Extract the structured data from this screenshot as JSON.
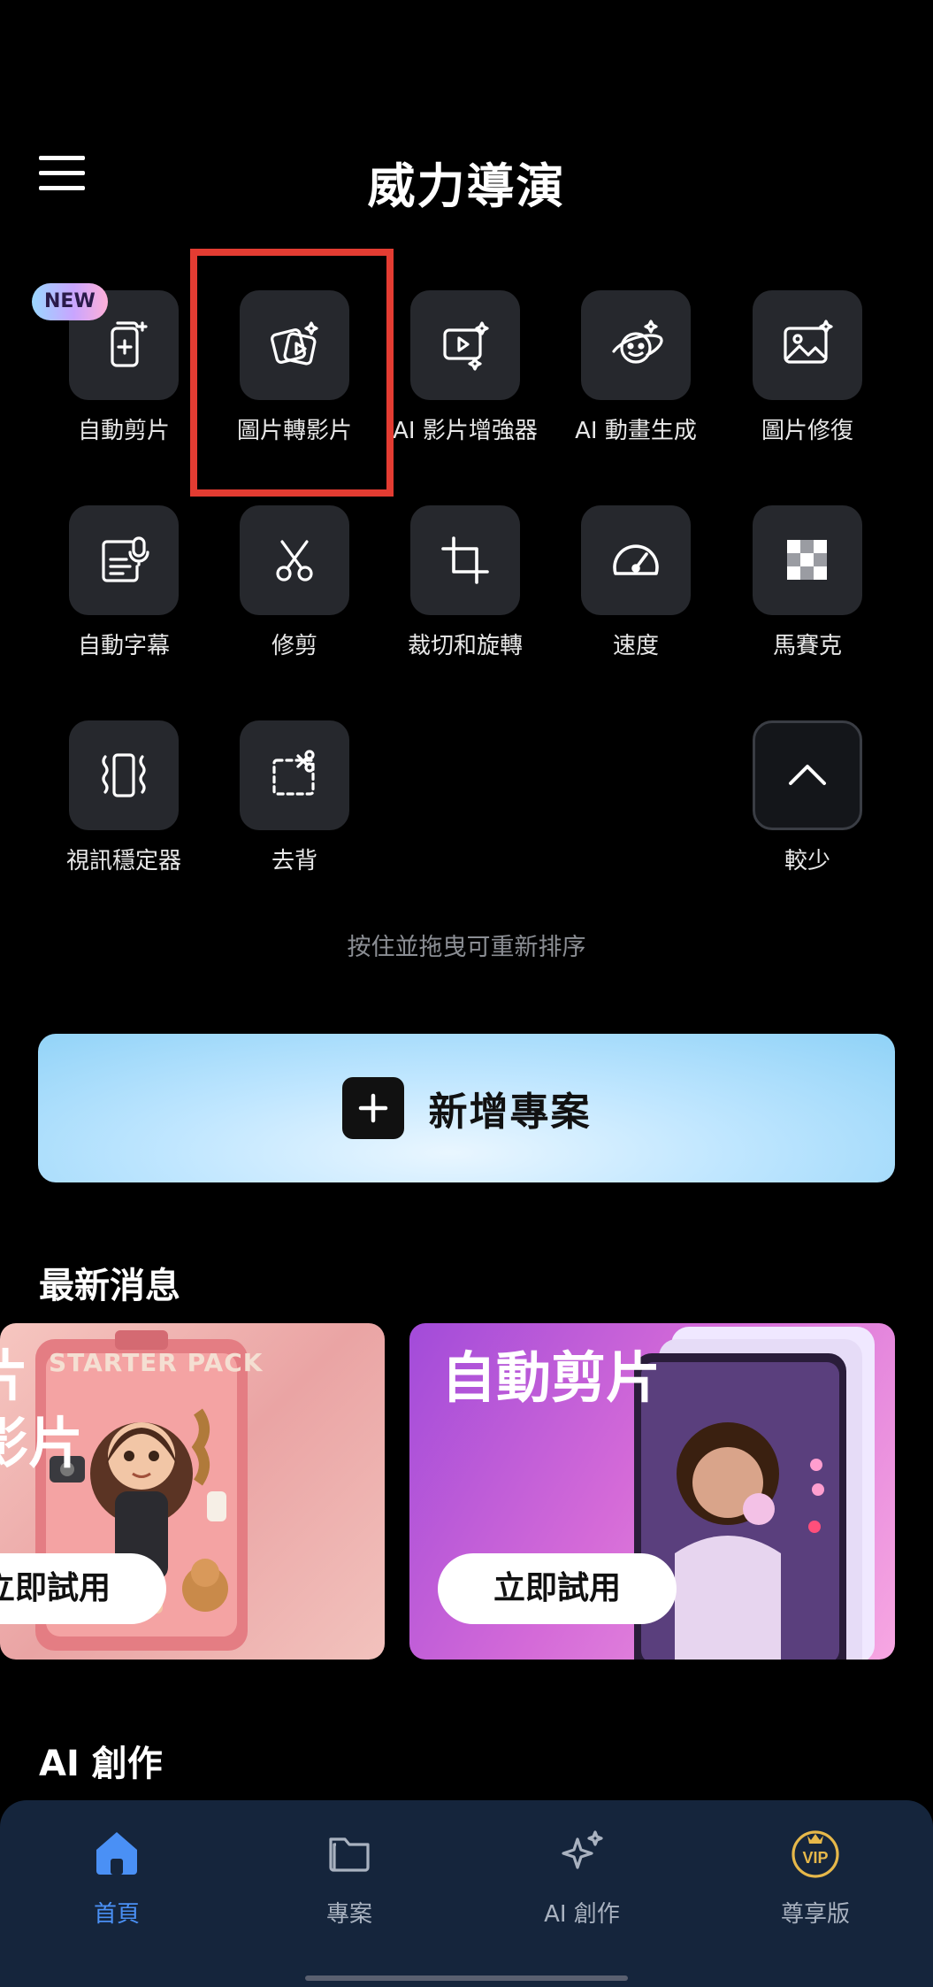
{
  "header": {
    "title": "威力導演"
  },
  "tools": {
    "auto_cut": "自動剪片",
    "photo_to_video": "圖片轉影片",
    "ai_video_enhancer": "AI 影片增強器",
    "ai_animation": "AI 動畫生成",
    "photo_restore": "圖片修復",
    "auto_subtitle": "自動字幕",
    "trim": "修剪",
    "crop_rotate": "裁切和旋轉",
    "speed": "速度",
    "mosaic": "馬賽克",
    "stabilizer": "視訊穩定器",
    "remove_bg": "去背",
    "less": "較少"
  },
  "badge": {
    "new": "NEW"
  },
  "hint": "按住並拖曳可重新排序",
  "new_project": {
    "label": "新增專案"
  },
  "news": {
    "title": "最新消息",
    "card_a": {
      "line1": "片",
      "line2": "影片",
      "button": "立即試用"
    },
    "card_b": {
      "title": "自動剪片",
      "button": "立即試用"
    }
  },
  "ai_section": {
    "title": "AI 創作"
  },
  "tabs": {
    "home": "首頁",
    "projects": "專案",
    "ai_create": "AI 創作",
    "vip": "尊享版"
  },
  "colors": {
    "accent": "#4a90f5",
    "highlight": "#e33c32",
    "tabbar": "#15253c"
  }
}
